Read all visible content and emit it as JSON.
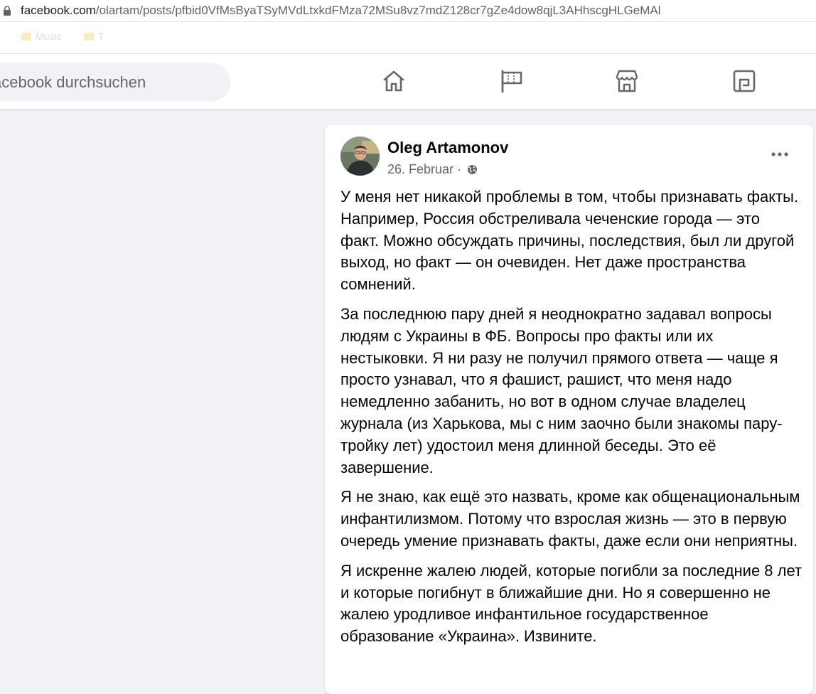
{
  "browser": {
    "url_domain": "facebook.com",
    "url_path": "/olartam/posts/pfbid0VfMsByaTSyMVdLtxkdFMza72MSu8vz7mdZ128cr7gZe4dow8qjL3AHhscgHLGeMAl",
    "bookmarks": [
      "Music",
      "T"
    ]
  },
  "header": {
    "search_placeholder": "acebook durchsuchen",
    "nav_icons": [
      "home-icon",
      "pages-flag-icon",
      "marketplace-icon",
      "gaming-icon"
    ]
  },
  "post": {
    "author": "Oleg Artamonov",
    "date": "26. Februar",
    "separator": "·",
    "audience_icon": "globe-icon",
    "paragraphs": [
      "У меня нет никакой проблемы в том, чтобы признавать факты. Например, Россия обстреливала чеченские города — это факт. Можно обсуждать причины, последствия, был ли другой выход, но факт — он очевиден. Нет даже пространства сомнений.",
      "За последнюю пару дней я неоднократно задавал вопросы людям с Украины в ФБ. Вопросы про факты или их нестыковки. Я ни разу не получил прямого ответа — чаще я просто узнавал, что я фашист, рашист, что меня надо немедленно забанить, но вот в одном случае владелец журнала (из Харькова, мы с ним заочно были знакомы пару-тройку лет) удостоил меня длинной беседы. Это её завершение.",
      "Я не знаю, как ещё это назвать, кроме как общенациональным инфантилизмом. Потому что взрослая жизнь — это в первую очередь умение признавать факты, даже если они неприятны.",
      "Я искренне жалею людей, которые погибли за последние 8 лет и которые погибнут в ближайшие дни. Но я совершенно не жалею уродливое инфантильное государственное образование «Украина». Извините."
    ]
  },
  "colors": {
    "page_bg": "#f0f2f5",
    "card_bg": "#ffffff",
    "text_primary": "#050505",
    "text_secondary": "#65676b",
    "icon_gray": "#65676b"
  }
}
